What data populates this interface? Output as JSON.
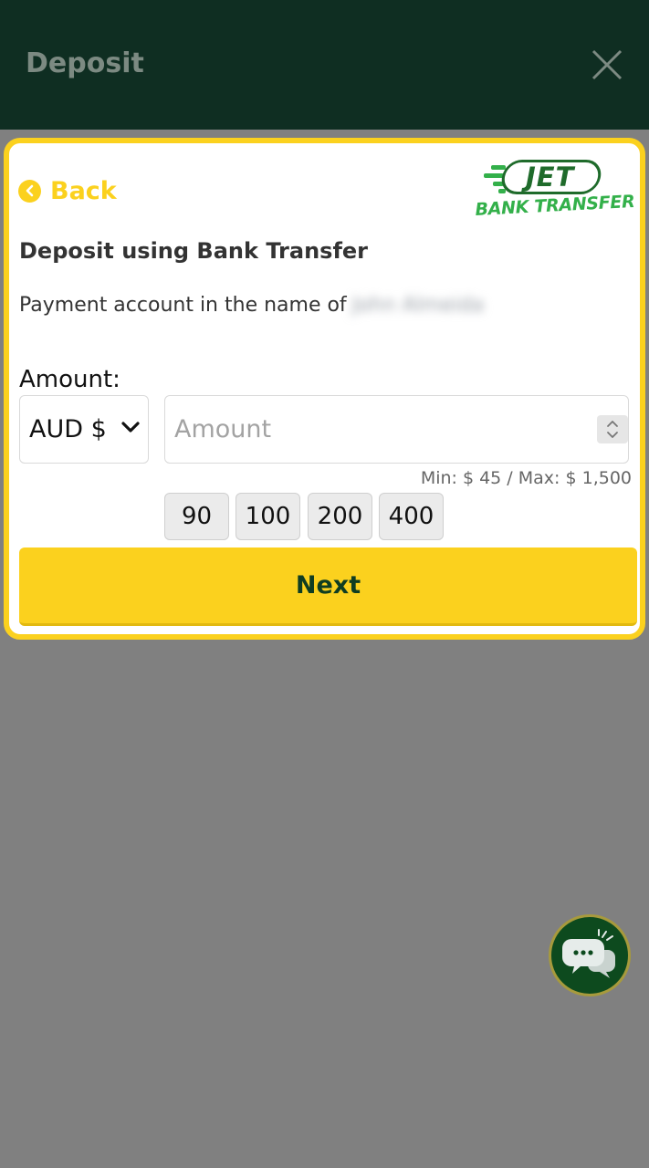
{
  "header": {
    "title": "Deposit",
    "close_icon": "close-icon"
  },
  "card": {
    "back_label": "Back",
    "back_icon": "chevron-left-circle-icon",
    "logo": {
      "main": "JET",
      "sub": "BANK TRANSFER"
    },
    "title": "Deposit using Bank Transfer",
    "account_prefix": "Payment account in the name of",
    "account_name": "John Almeida",
    "amount_label": "Amount:",
    "currency": {
      "selected": "AUD $",
      "icon": "chevron-down-icon"
    },
    "amount_input": {
      "value": "",
      "placeholder": "Amount"
    },
    "limits": "Min: $ 45 / Max: $ 1,500",
    "quick_amounts": [
      "90",
      "100",
      "200",
      "400"
    ],
    "next_label": "Next"
  },
  "chat": {
    "icon": "chat-bubbles-icon"
  },
  "colors": {
    "header_bg": "#0f2e22",
    "accent_yellow": "#fbd11e",
    "brand_green": "#0f3d22",
    "overlay_gray": "#808080"
  }
}
